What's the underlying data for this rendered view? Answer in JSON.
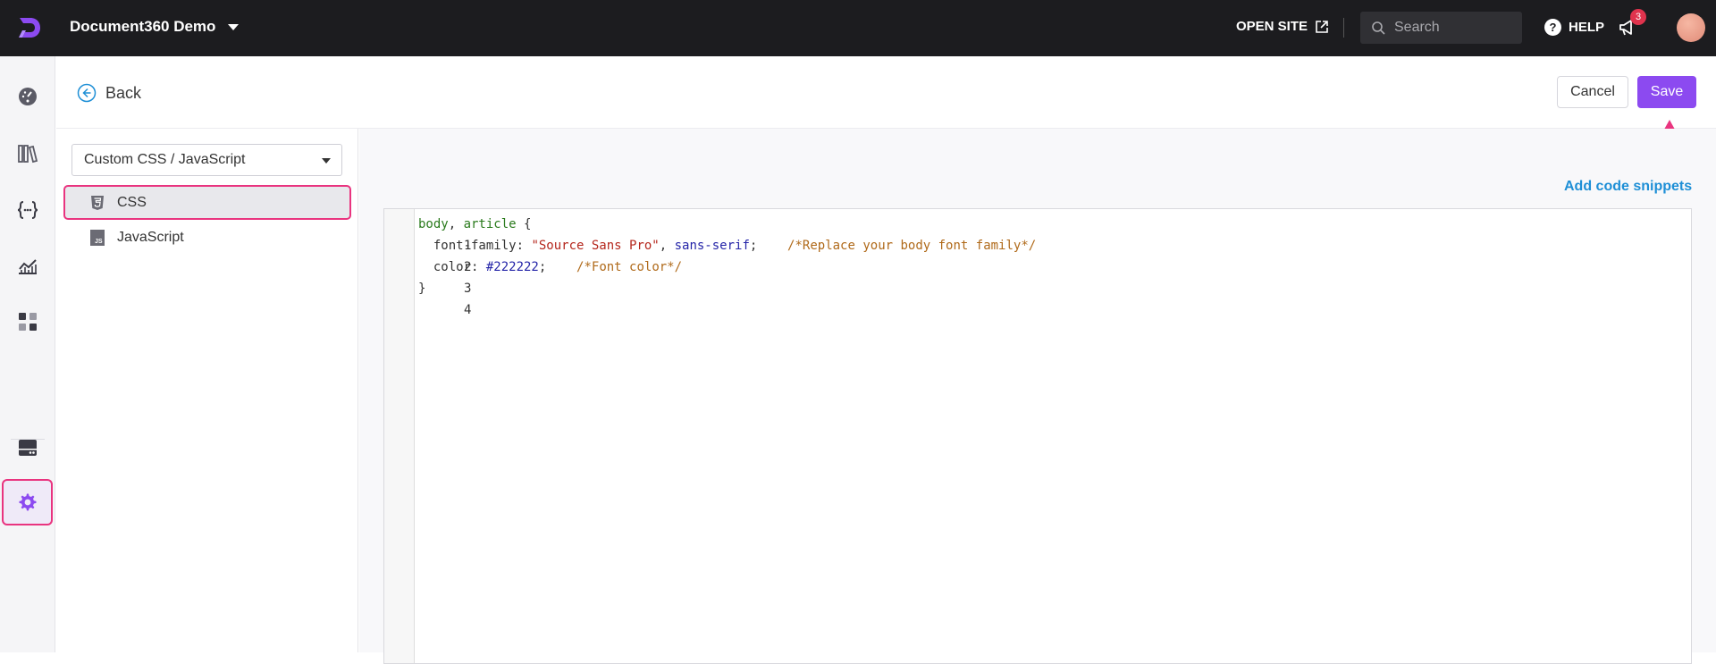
{
  "topbar": {
    "project_name": "Document360 Demo",
    "open_site_label": "OPEN SITE",
    "search_placeholder": "Search",
    "help_label": "HELP",
    "notification_count": "3"
  },
  "rail": {
    "items": [
      {
        "name": "dashboard",
        "icon": "gauge-icon"
      },
      {
        "name": "documentation",
        "icon": "books-icon"
      },
      {
        "name": "api-documentation",
        "icon": "code-braces-icon"
      },
      {
        "name": "analytics",
        "icon": "chart-line-icon"
      },
      {
        "name": "widgets",
        "icon": "apps-grid-icon"
      },
      {
        "name": "drive",
        "icon": "drive-icon"
      },
      {
        "name": "settings",
        "icon": "gear-icon",
        "active": true
      }
    ]
  },
  "header": {
    "back_label": "Back",
    "cancel_label": "Cancel",
    "save_label": "Save"
  },
  "panel": {
    "dropdown_value": "Custom CSS / JavaScript",
    "files": [
      {
        "label": "CSS",
        "icon": "css3-icon",
        "active": true
      },
      {
        "label": "JavaScript",
        "icon": "js-icon",
        "active": false
      }
    ]
  },
  "editor": {
    "add_snippets_label": "Add code snippets",
    "line_numbers": [
      "1",
      "2",
      "3",
      "4"
    ],
    "lines": {
      "l1_selector1": "body",
      "l1_comma": ", ",
      "l1_selector2": "article",
      "l1_brace": " {",
      "l2_prop": "  font-family: ",
      "l2_string": "\"Source Sans Pro\"",
      "l2_comma": ", ",
      "l2_value": "sans-serif",
      "l2_semi": ";    ",
      "l2_comment": "/*Replace your body font family*/",
      "l3_prop": "  color: ",
      "l3_value": "#222222",
      "l3_semi": ";    ",
      "l3_comment": "/*Font color*/",
      "l4_brace": "}"
    }
  },
  "colors": {
    "accent": "#8c4af0",
    "highlight": "#e9347f",
    "link": "#1e8fd6"
  }
}
